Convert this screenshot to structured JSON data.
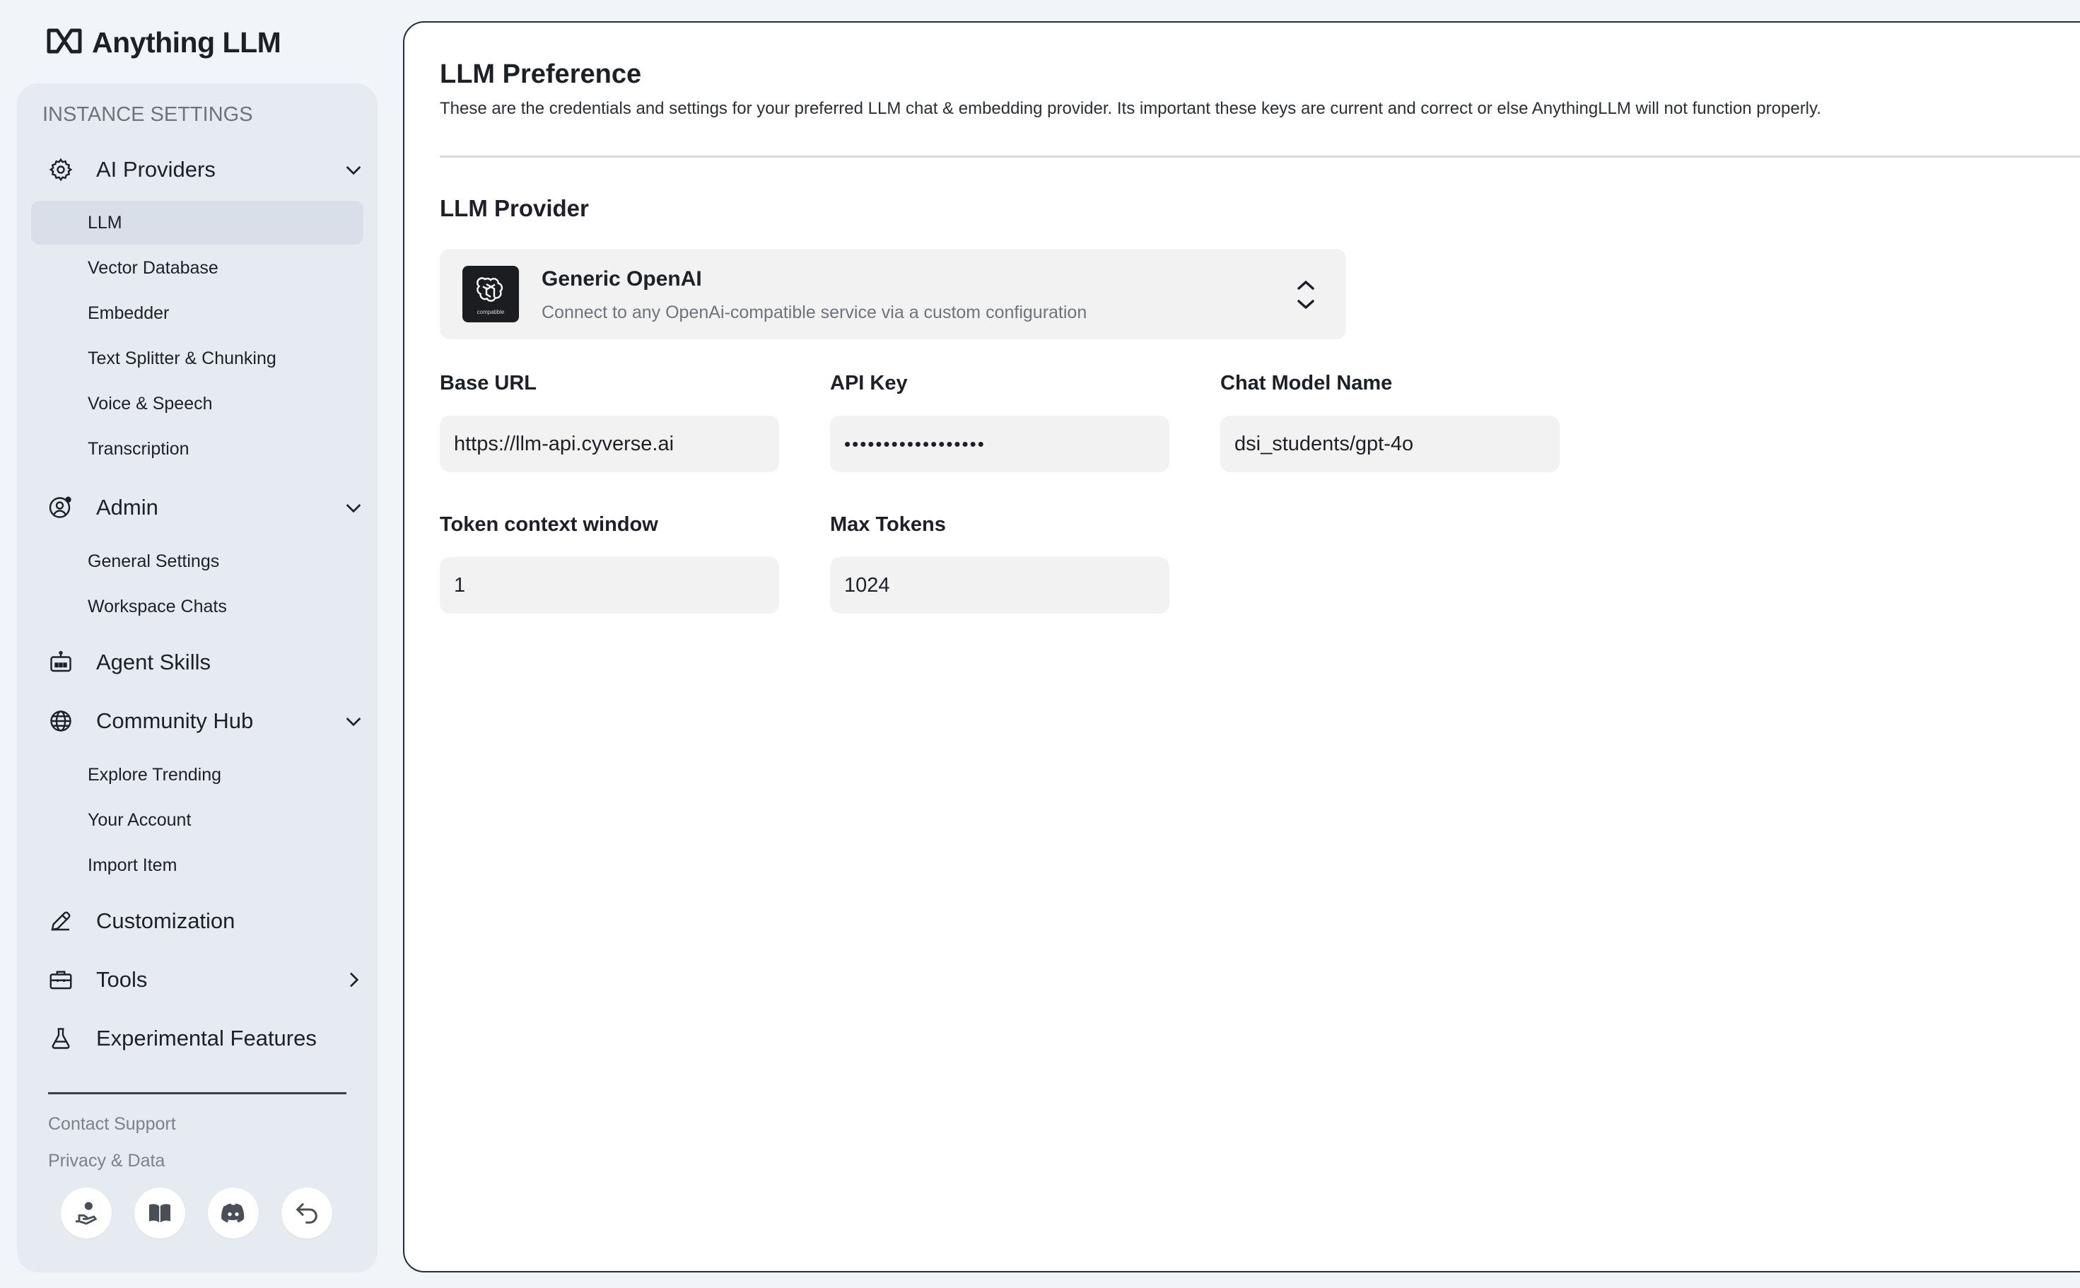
{
  "app": {
    "title": "Anything LLM"
  },
  "sidebar": {
    "section_title": "INSTANCE SETTINGS",
    "groups": {
      "ai_providers": {
        "label": "AI Providers",
        "icon": "gear-icon"
      },
      "admin": {
        "label": "Admin",
        "icon": "user-gear-icon"
      },
      "agent_skills": {
        "label": "Agent Skills",
        "icon": "robot-icon"
      },
      "community_hub": {
        "label": "Community Hub",
        "icon": "globe-icon"
      },
      "customization": {
        "label": "Customization",
        "icon": "pencil-icon"
      },
      "tools": {
        "label": "Tools",
        "icon": "toolbox-icon"
      },
      "experimental": {
        "label": "Experimental Features",
        "icon": "flask-icon"
      }
    },
    "ai_items": [
      "LLM",
      "Vector Database",
      "Embedder",
      "Text Splitter & Chunking",
      "Voice & Speech",
      "Transcription"
    ],
    "admin_items": [
      "General Settings",
      "Workspace Chats"
    ],
    "community_items": [
      "Explore Trending",
      "Your Account",
      "Import Item"
    ],
    "active_item": "LLM",
    "footer": {
      "contact_support": "Contact Support",
      "privacy": "Privacy & Data",
      "icons": [
        "donate-hand-icon",
        "book-icon",
        "discord-icon",
        "back-arrow-icon"
      ]
    }
  },
  "main": {
    "title": "LLM Preference",
    "description": "These are the credentials and settings for your preferred LLM chat & embedding provider. Its important these keys are current and correct or else AnythingLLM will not function properly.",
    "provider_section": "LLM Provider",
    "provider": {
      "name": "Generic OpenAI",
      "description": "Connect to any OpenAi-compatible service via a custom configuration",
      "logo_caption": "compatible"
    },
    "fields": {
      "base_url": {
        "label": "Base URL",
        "value": "https://llm-api.cyverse.ai"
      },
      "api_key": {
        "label": "API Key",
        "value": "••••••••••••••••••"
      },
      "chat_model": {
        "label": "Chat Model Name",
        "value": "dsi_students/gpt-4o"
      },
      "token_window": {
        "label": "Token context window",
        "value": "1"
      },
      "max_tokens": {
        "label": "Max Tokens",
        "value": "1024"
      }
    }
  },
  "colors": {
    "sidebar_bg": "#e6ebf2",
    "page_bg": "#f1f4f8",
    "field_bg": "#f2f2f2",
    "active_bg": "#d9dfe8"
  }
}
